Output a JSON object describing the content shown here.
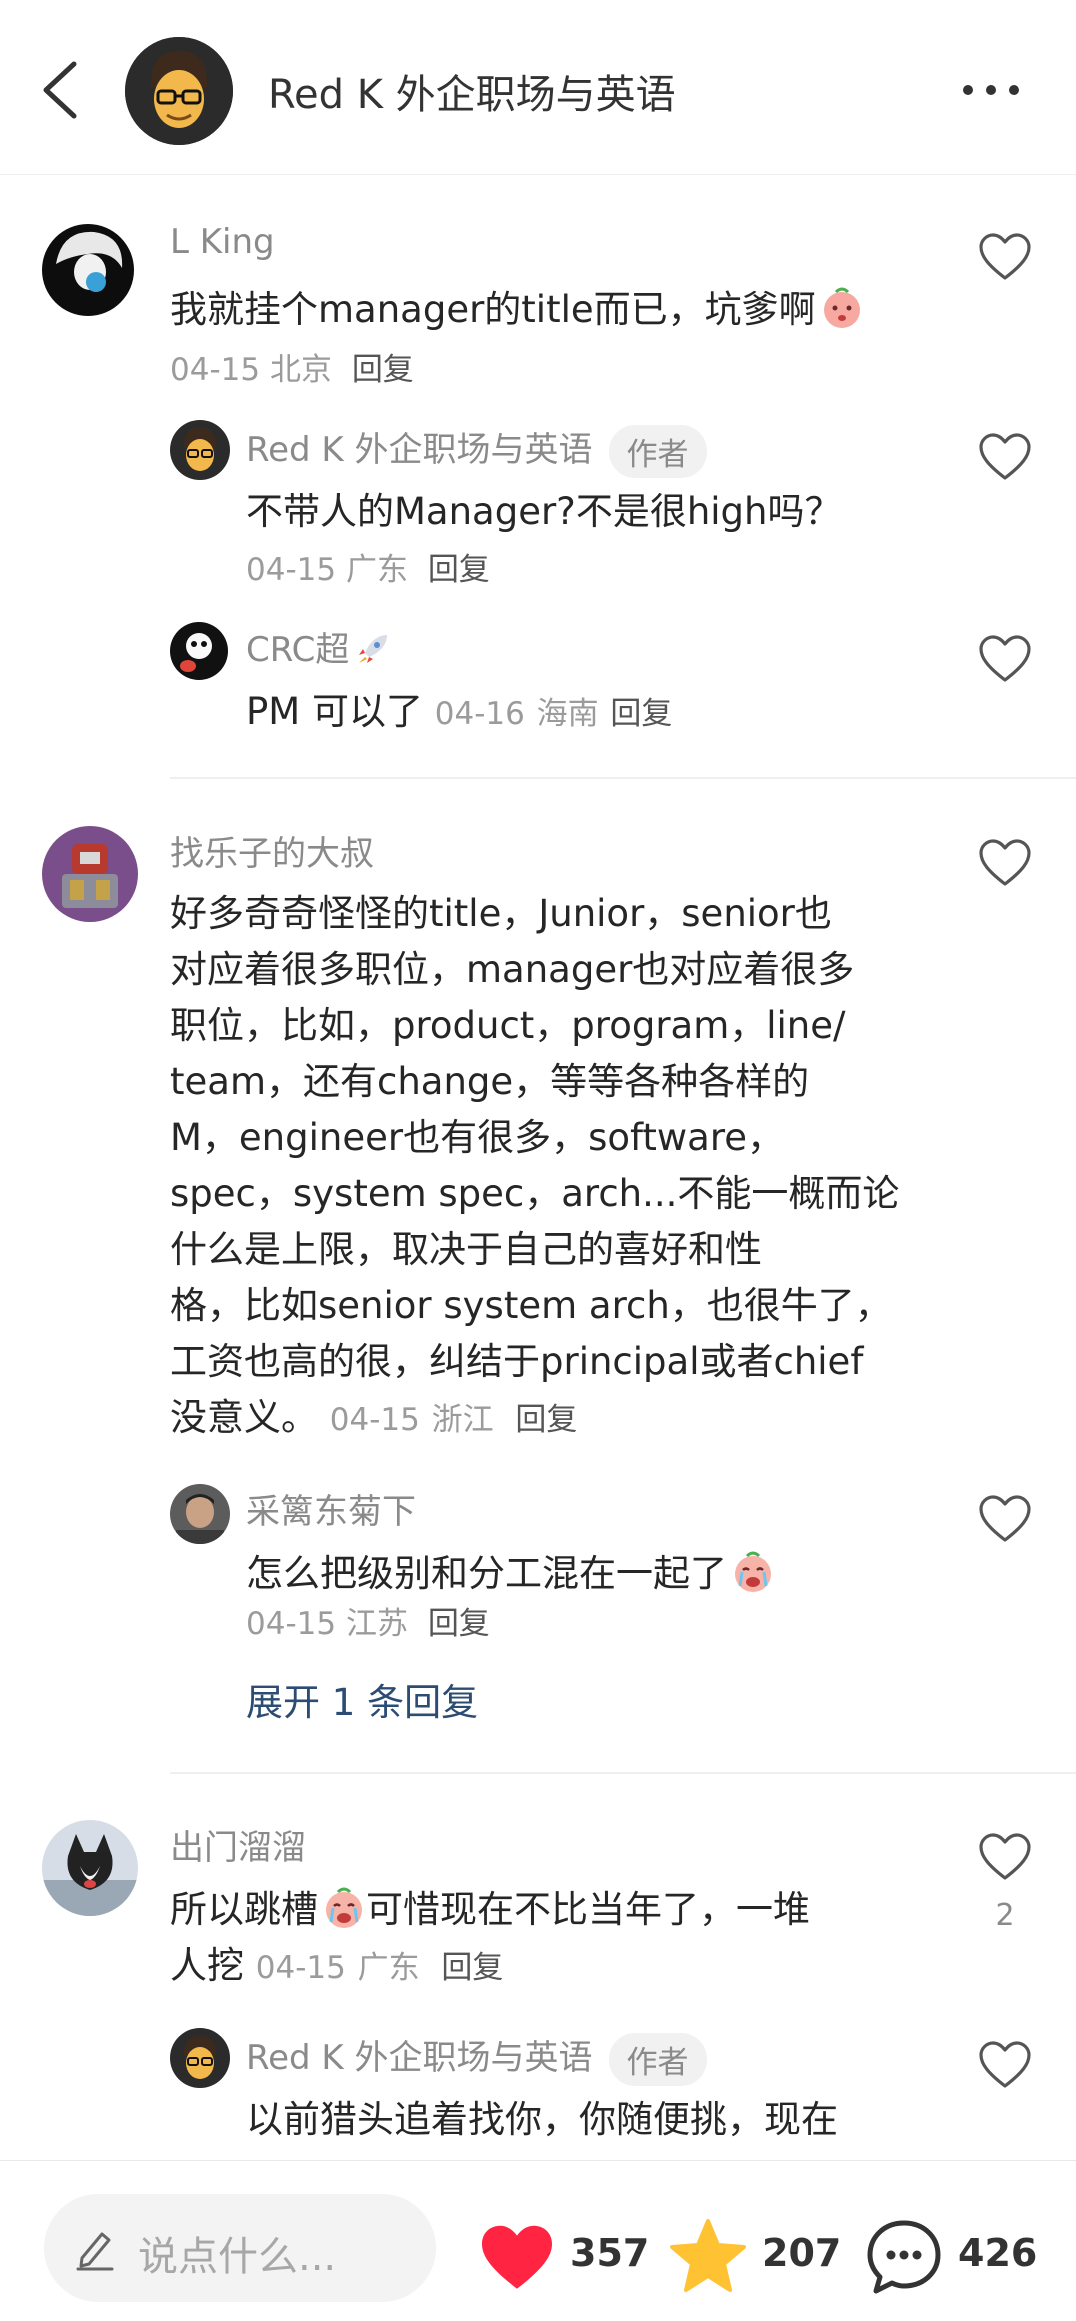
{
  "header": {
    "title": "Red K 外企职场与英语"
  },
  "comments": [
    {
      "name": "L King",
      "text": "我就挂个manager的title而已，坑爹啊",
      "date": "04-15",
      "location": "北京",
      "reply": "回复",
      "replies": [
        {
          "name": "Red K 外企职场与英语",
          "badge": "作者",
          "text": "不带人的Manager?不是很high吗？",
          "date": "04-15",
          "location": "广东",
          "reply": "回复"
        },
        {
          "name": "CRC超",
          "text": "PM 可以了",
          "date": "04-16",
          "location": "海南",
          "reply": "回复"
        }
      ]
    },
    {
      "name": "找乐子的大叔",
      "lines": [
        "好多奇奇怪怪的title，Junior，senior也",
        "对应着很多职位，manager也对应着很多",
        "职位，比如，product，program，line/",
        "team，还有change，等等各种各样的",
        "M，engineer也有很多，software，",
        "spec，system spec，arch...不能一概而论",
        "什么是上限，取决于自己的喜好和性",
        "格，比如senior system arch，也很牛了，",
        "工资也高的很，纠结于principal或者chief",
        "没意义。"
      ],
      "date": "04-15",
      "location": "浙江",
      "reply": "回复",
      "replies": [
        {
          "name": "采篱东菊下",
          "text": "怎么把级别和分工混在一起了",
          "date": "04-15",
          "location": "江苏",
          "reply": "回复"
        }
      ],
      "expand": "展开 1 条回复"
    },
    {
      "name": "出门溜溜",
      "text_a": "所以跳槽",
      "text_b": "可惜现在不比当年了，一堆",
      "text_c": "人挖",
      "date": "04-15",
      "location": "广东",
      "reply": "回复",
      "likes": "2",
      "replies": [
        {
          "name": "Red K 外企职场与英语",
          "badge": "作者",
          "text": "以前猎头追着找你，你随便挑，现在"
        }
      ]
    }
  ],
  "bottom": {
    "placeholder": "说点什么...",
    "likes": "357",
    "favorites": "207",
    "comments": "426"
  },
  "colors": {
    "heart_active": "#ff2442",
    "star_active": "#ffc233",
    "expand_link": "#2c4c74"
  }
}
